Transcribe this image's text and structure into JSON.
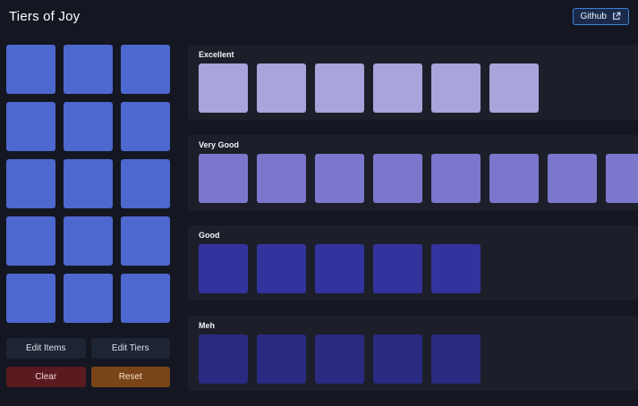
{
  "header": {
    "title": "Tiers of Joy",
    "github": {
      "label": "Github",
      "icon": "external-link-icon"
    }
  },
  "pool": {
    "count": 15,
    "color": "#4d68ce"
  },
  "tiers": [
    {
      "label": "Excellent",
      "count": 6,
      "color": "#a8a4dc"
    },
    {
      "label": "Very Good",
      "count": 8,
      "color": "#7a77cc"
    },
    {
      "label": "Good",
      "count": 5,
      "color": "#33339e"
    },
    {
      "label": "Meh",
      "count": 5,
      "color": "#2a2a80"
    }
  ],
  "buttons": {
    "edit_items": "Edit Items",
    "edit_tiers": "Edit Tiers",
    "clear": "Clear",
    "reset": "Reset"
  },
  "colors": {
    "page_bg": "#141722",
    "row_bg": "#1c1f2a",
    "accent_border": "#3f7fd4",
    "clear_bg": "#5a1a1f",
    "reset_bg": "#7a4419"
  }
}
